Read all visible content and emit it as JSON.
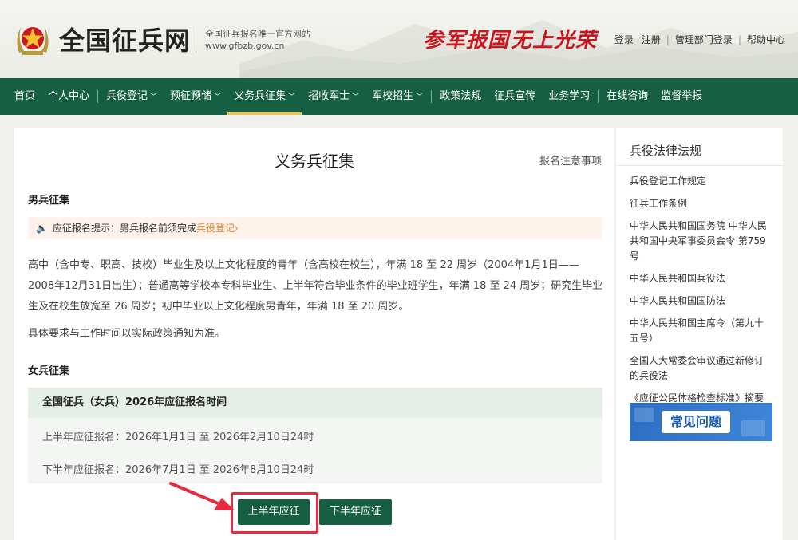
{
  "header": {
    "site_title": "全国征兵网",
    "sub1": "全国征兵报名唯一官方网站",
    "sub2": "www.gfbzb.gov.cn",
    "slogan1": "参军报国",
    "slogan2": "无上光荣",
    "links": [
      "登录",
      "注册",
      "管理部门登录",
      "帮助中心"
    ]
  },
  "nav": {
    "items": [
      {
        "label": "首页"
      },
      {
        "label": "个人中心"
      },
      {
        "label": "兵役登记"
      },
      {
        "label": "预征预储"
      },
      {
        "label": "义务兵征集"
      },
      {
        "label": "招收军士"
      },
      {
        "label": "军校招生"
      },
      {
        "label": "政策法规"
      },
      {
        "label": "征兵宣传"
      },
      {
        "label": "业务学习"
      },
      {
        "label": "在线咨询"
      },
      {
        "label": "监督举报"
      }
    ],
    "active": "义务兵征集"
  },
  "main": {
    "title": "义务兵征集",
    "notice_link": "报名注意事项",
    "male_heading": "男兵征集",
    "tip_prefix": "应征报名提示：男兵报名前须完成",
    "tip_link": "兵役登记",
    "tip_chevron": "›",
    "male_para": "高中（含中专、职高、技校）毕业生及以上文化程度的青年（含高校在校生），年满 18 至 22 周岁（2004年1月1日——2008年12月31日出生）；普通高等学校本专科毕业生、上半年符合毕业条件的毕业班学生，年满 18 至 24 周岁；研究生毕业生及在校生放宽至 26 周岁；初中毕业以上文化程度男青年，年满 18 至 20 周岁。",
    "note_para": "具体要求与工作时间以实际政策通知为准。",
    "female_heading": "女兵征集",
    "time_box": {
      "head": "全国征兵（女兵）2026年应征报名时间",
      "row1": "上半年应征报名：2026年1月1日 至 2026年2月10日24时",
      "row2": "下半年应征报名：2026年7月1日 至 2026年8月10日24时"
    },
    "btn_first_half": "上半年应征",
    "btn_second_half": "下半年应征"
  },
  "sidebar": {
    "title": "兵役法律法规",
    "items": [
      "兵役登记工作规定",
      "征兵工作条例",
      "中华人民共和国国务院 中华人民共和国中央军事委员会令 第759号",
      "中华人民共和国兵役法",
      "中华人民共和国国防法",
      "中华人民共和国主席令（第九十五号）",
      "全国人大常委会审议通过新修订的兵役法",
      "《应征公民体格检查标准》摘要"
    ],
    "faq": "常见问题"
  },
  "colors": {
    "primary_green": "#165f43",
    "accent_orange": "#e6802e",
    "slogan_red": "#c8171e",
    "highlight_red": "#e52b3e"
  }
}
